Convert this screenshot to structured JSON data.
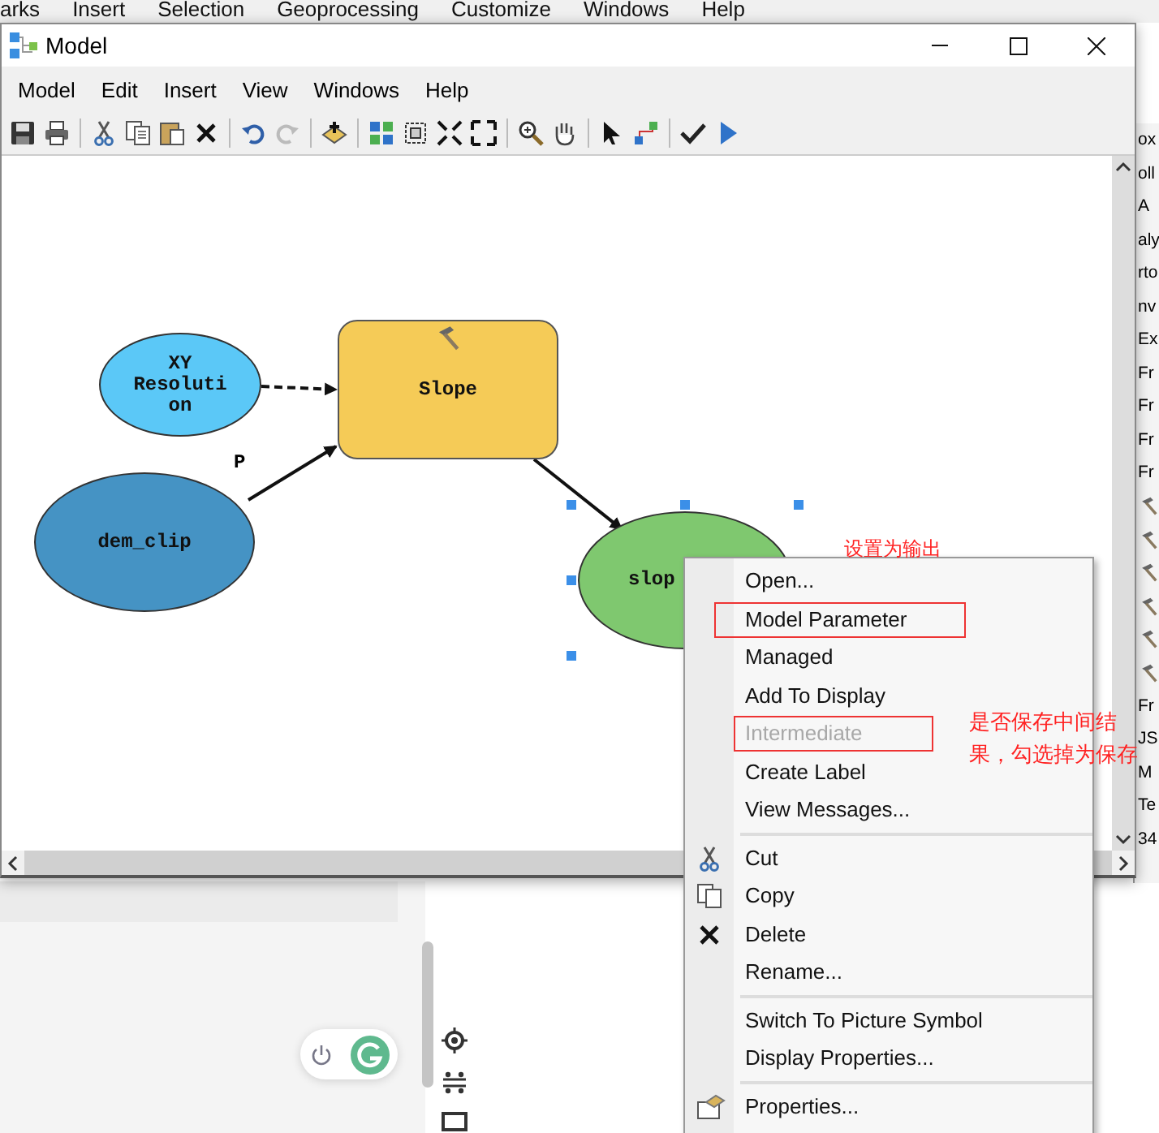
{
  "background_menu": [
    "arks",
    "Insert",
    "Selection",
    "Geoprocessing",
    "Customize",
    "Windows",
    "Help"
  ],
  "window": {
    "title": "Model"
  },
  "menu": [
    "Model",
    "Edit",
    "Insert",
    "View",
    "Windows",
    "Help"
  ],
  "diagram": {
    "nodes": [
      {
        "label": "XY Resolution",
        "kind": "variable",
        "color": "#5bc8f7",
        "selected": false
      },
      {
        "label": "Slope",
        "kind": "tool",
        "color": "#f5cb57",
        "selected": false
      },
      {
        "label": "dem_clip",
        "kind": "variable",
        "color": "#4593c4",
        "selected": false
      },
      {
        "label": "slop",
        "kind": "variable",
        "color": "#7fc86f",
        "selected": true
      }
    ],
    "connections": [
      {
        "dashed": true
      },
      {
        "dashed": false,
        "label": "P"
      },
      {
        "dashed": false
      }
    ]
  },
  "context_menu": {
    "sections": [
      [
        {
          "label": "Open...",
          "disabled": false,
          "highlighted": false
        },
        {
          "label": "Model Parameter",
          "disabled": false,
          "highlighted": true
        },
        {
          "label": "Managed",
          "disabled": false,
          "highlighted": false
        },
        {
          "label": "Add To Display",
          "disabled": false,
          "highlighted": false
        },
        {
          "label": "Intermediate",
          "disabled": true,
          "highlighted": true
        },
        {
          "label": "Create Label",
          "disabled": false,
          "highlighted": false
        },
        {
          "label": "View Messages...",
          "disabled": false,
          "highlighted": false
        }
      ],
      [
        {
          "label": "Cut",
          "disabled": false,
          "highlighted": false
        },
        {
          "label": "Copy",
          "disabled": false,
          "highlighted": false
        },
        {
          "label": "Delete",
          "disabled": false,
          "highlighted": false
        },
        {
          "label": "Rename...",
          "disabled": false,
          "highlighted": false
        }
      ],
      [
        {
          "label": "Switch To Picture Symbol",
          "disabled": false,
          "highlighted": false
        },
        {
          "label": "Display Properties...",
          "disabled": false,
          "highlighted": false
        }
      ],
      [
        {
          "label": "Properties...",
          "disabled": false,
          "highlighted": false
        }
      ]
    ]
  },
  "annotations": [
    "设置为输出",
    "是否保存中间结果，勾选掉为保存"
  ],
  "side_panel": [
    {
      "kind": "text",
      "label": "ox"
    },
    {
      "kind": "text",
      "label": "oll"
    },
    {
      "kind": "text",
      "label": "A"
    },
    {
      "kind": "text",
      "label": "aly"
    },
    {
      "kind": "text",
      "label": "rto"
    },
    {
      "kind": "text",
      "label": "nv"
    },
    {
      "kind": "text",
      "label": "Ex"
    },
    {
      "kind": "text",
      "label": "Fr"
    },
    {
      "kind": "text",
      "label": "Fr"
    },
    {
      "kind": "text",
      "label": "Fr"
    },
    {
      "kind": "text",
      "label": "Fr"
    },
    {
      "kind": "tool"
    },
    {
      "kind": "tool"
    },
    {
      "kind": "tool"
    },
    {
      "kind": "tool"
    },
    {
      "kind": "tool"
    },
    {
      "kind": "tool"
    },
    {
      "kind": "text",
      "label": "Fr"
    },
    {
      "kind": "text",
      "label": "JS"
    },
    {
      "kind": "text",
      "label": "M"
    },
    {
      "kind": "text",
      "label": "Te"
    },
    {
      "kind": "text",
      "label": "34"
    }
  ]
}
